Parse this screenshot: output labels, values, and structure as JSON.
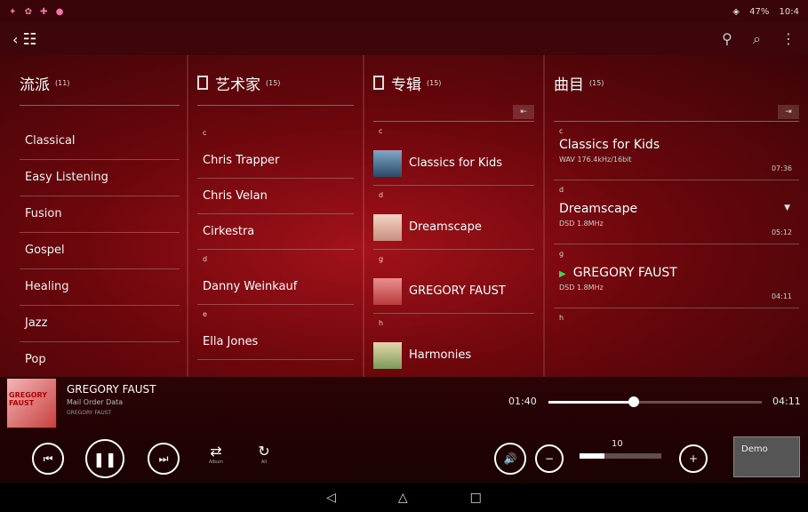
{
  "status": {
    "left_icons": [
      "✦",
      "✿",
      "✚",
      "●"
    ],
    "battery": "47%",
    "time": "10:4"
  },
  "appbar": {
    "back": "‹",
    "grid": "☷",
    "filter": "⚲",
    "search": "⌕",
    "menu": "⋮"
  },
  "genres": {
    "title": "流派",
    "count": "(11)",
    "items": [
      "Classical",
      "Easy Listening",
      "Fusion",
      "Gospel",
      "Healing",
      "Jazz",
      "Pop"
    ]
  },
  "artists": {
    "title": "艺术家",
    "count": "(15)",
    "letter_c": "c",
    "items_c": [
      "Chris Trapper",
      "Chris Velan",
      "Cirkestra"
    ],
    "letter_d": "d",
    "items_d": [
      "Danny Weinkauf"
    ],
    "letter_e": "e",
    "partial": "Ella Jones"
  },
  "albums": {
    "title": "专辑",
    "count": "(15)",
    "letter_c": "c",
    "a1": "Classics for Kids",
    "letter_d": "d",
    "a2": "Dreamscape",
    "letter_g": "g",
    "a3": "GREGORY FAUST",
    "letter_h": "h",
    "a4": "Harmonies"
  },
  "tracks": {
    "title": "曲目",
    "count": "(15)",
    "letter_c": "c",
    "t1_title": "Classics for Kids",
    "t1_meta": "WAV 176.4kHz/16bit",
    "t1_dur": "07:36",
    "letter_d": "d",
    "t2_title": "Dreamscape",
    "t2_meta": "DSD 1.8MHz",
    "t2_dur": "05:12",
    "letter_g": "g",
    "t3_title": "GREGORY FAUST",
    "t3_meta": "DSD 1.8MHz",
    "t3_dur": "04:11",
    "letter_h": "h"
  },
  "player": {
    "cover_text": "GREGORY FAUST",
    "title": "GREGORY FAUST",
    "album": "Mail Order Data",
    "artist": "GREGORY FAUST",
    "current_time": "01:40",
    "total_time": "04:11",
    "progress": 0.4,
    "volume": "10",
    "volume_level": 0.3,
    "repeat_label": "Album",
    "shuffle_label": "All",
    "demo_label": "Demo"
  },
  "nav": {
    "back": "◁",
    "home": "△",
    "recent": "□"
  }
}
